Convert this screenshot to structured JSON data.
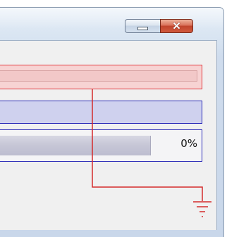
{
  "window": {
    "minimize_glyph": "minimize-icon",
    "close_glyph": "✕"
  },
  "progress": {
    "label": "0%",
    "value": 0
  },
  "icons": {
    "ground": "ground-symbol-icon"
  },
  "colors": {
    "red_outline": "#e0393e",
    "red_fill": "#f7d3d3",
    "blue_outline": "#2b2bb8",
    "blue_fill": "#cfd1ee",
    "close_button": "#c0442c"
  }
}
